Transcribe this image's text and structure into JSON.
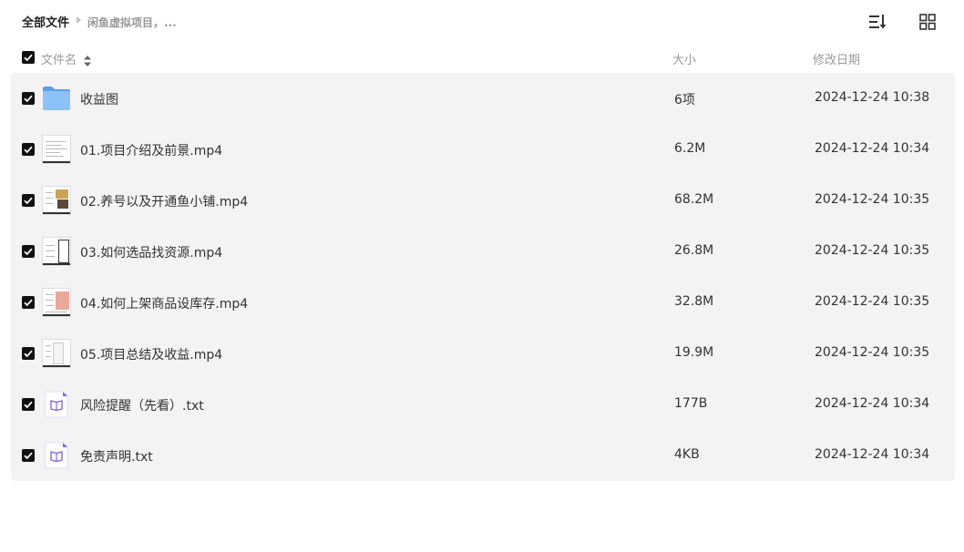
{
  "breadcrumb": {
    "root": "全部文件",
    "current": "闲鱼虚拟项目，..."
  },
  "toolbar": {
    "sort_icon": "sort-list-icon",
    "view_icon": "grid-view-icon"
  },
  "columns": {
    "name": "文件名",
    "size": "大小",
    "date": "修改日期"
  },
  "files": [
    {
      "name": "收益图",
      "size": "6项",
      "date": "2024-12-24 10:38",
      "type": "folder",
      "checked": true
    },
    {
      "name": "01.项目介绍及前景.mp4",
      "size": "6.2M",
      "date": "2024-12-24 10:34",
      "type": "video",
      "checked": true
    },
    {
      "name": "02.养号以及开通鱼小铺.mp4",
      "size": "68.2M",
      "date": "2024-12-24 10:35",
      "type": "video",
      "checked": true
    },
    {
      "name": "03.如何选品找资源.mp4",
      "size": "26.8M",
      "date": "2024-12-24 10:35",
      "type": "video",
      "checked": true
    },
    {
      "name": "04.如何上架商品设库存.mp4",
      "size": "32.8M",
      "date": "2024-12-24 10:35",
      "type": "video",
      "checked": true
    },
    {
      "name": "05.项目总结及收益.mp4",
      "size": "19.9M",
      "date": "2024-12-24 10:35",
      "type": "video",
      "checked": true
    },
    {
      "name": "风险提醒（先看）.txt",
      "size": "177B",
      "date": "2024-12-24 10:34",
      "type": "text",
      "checked": true
    },
    {
      "name": "免责声明.txt",
      "size": "4KB",
      "date": "2024-12-24 10:34",
      "type": "text",
      "checked": true
    }
  ],
  "colors": {
    "row_background": "#f3f3f3",
    "checkbox": "#111111",
    "folder": "#7fb6f2",
    "text_file_icon": "#7b6bd6"
  }
}
